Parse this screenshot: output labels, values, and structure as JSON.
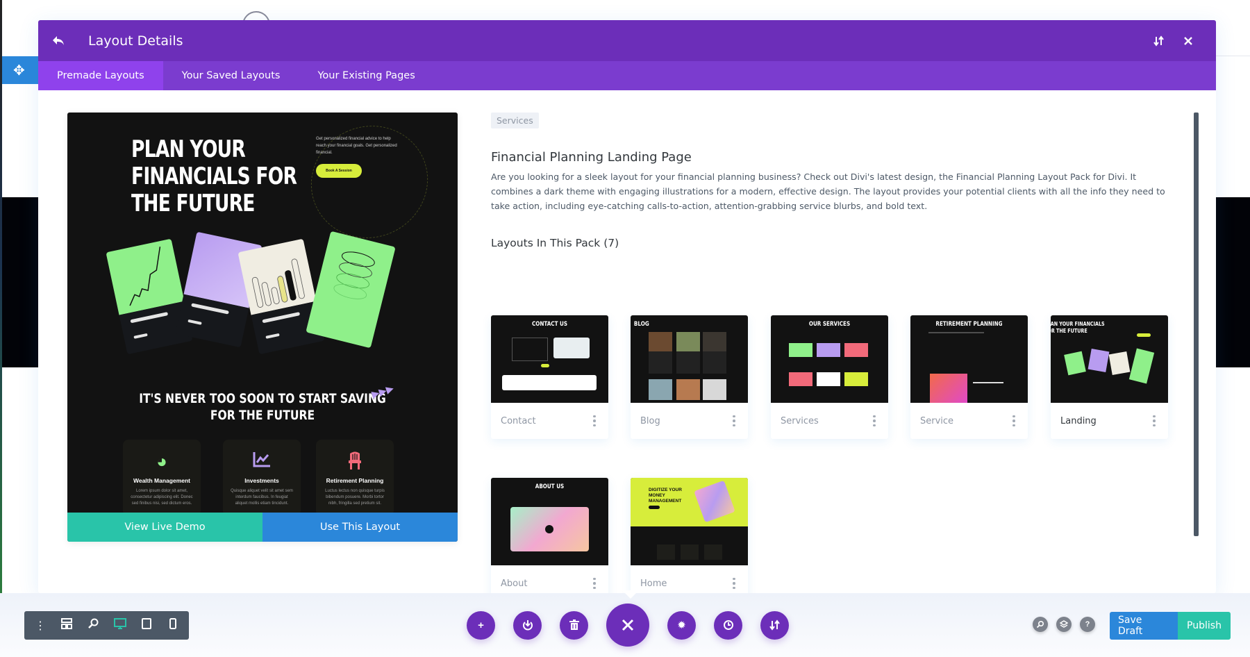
{
  "modal": {
    "title": "Layout Details",
    "back_icon": "back-arrow-icon",
    "sort_icon": "sort-arrows-icon",
    "close_icon": "close-icon",
    "tabs": [
      {
        "label": "Premade Layouts",
        "active": true
      },
      {
        "label": "Your Saved Layouts",
        "active": false
      },
      {
        "label": "Your Existing Pages",
        "active": false
      }
    ]
  },
  "preview": {
    "hero_title_lines": [
      "PLAN YOUR",
      "FINANCIALS FOR",
      "THE FUTURE"
    ],
    "hero_subtext": "Get personalized financial advice to help reach your financial goals. Get personalized financial.",
    "hero_button": "Book A Session",
    "section_title_lines": [
      "IT'S NEVER TOO SOON TO START SAVING",
      "FOR THE FUTURE"
    ],
    "services": [
      {
        "name": "Wealth Management",
        "icon": "pie-chart-icon",
        "color": "#8ff08a",
        "text": "Lorem ipsum dolor sit amet, consectetur adipiscing elit. Donec sed finibus nisi, sed dictum eros."
      },
      {
        "name": "Investments",
        "icon": "line-chart-icon",
        "color": "#b89cf0",
        "text": "Quisque aliquet velit sit amet sem interdum faucibus. In feugiat aliquet mollis etiam tincidunt."
      },
      {
        "name": "Retirement Planning",
        "icon": "chair-icon",
        "color": "#f26a7a",
        "text": "Luctus lectus non quisque turpis bibendum posuere. Morbi tortor nibh, fringilla sed pretium sit."
      }
    ],
    "view_demo_label": "View Live Demo",
    "use_layout_label": "Use This Layout"
  },
  "details": {
    "category_tag": "Services",
    "title": "Financial Planning Landing Page",
    "description": "Are you looking for a sleek layout for your financial planning business? Check out Divi's latest design, the Financial Planning Layout Pack for Divi. It combines a dark theme with engaging illustrations for a modern, effective design. The layout provides your potential clients with all the info they need to take action, including eye-catching calls-to-action, attention-grabbing service blurbs, and bold text.",
    "pack_title": "Layouts In This Pack (7)",
    "layouts": [
      {
        "name": "Contact",
        "thumb_title": "CONTACT US",
        "active": false
      },
      {
        "name": "Blog",
        "thumb_title": "BLOG",
        "active": false
      },
      {
        "name": "Services",
        "thumb_title": "OUR SERVICES",
        "active": false
      },
      {
        "name": "Service",
        "thumb_title": "RETIREMENT PLANNING",
        "active": false
      },
      {
        "name": "Landing",
        "thumb_title": "PLAN YOUR FINANCIALS FOR THE FUTURE",
        "active": true
      },
      {
        "name": "About",
        "thumb_title": "ABOUT US",
        "active": false
      },
      {
        "name": "Home",
        "thumb_title": "DIGITIZE YOUR MONEY MANAGEMENT",
        "active": false
      }
    ]
  },
  "toolbar": {
    "left_icons": [
      "more-vertical-icon",
      "wireframe-icon",
      "zoom-icon",
      "desktop-icon",
      "tablet-icon",
      "phone-icon"
    ],
    "active_view": "desktop-icon",
    "center_icons": [
      "add-icon",
      "portability-icon",
      "trash-icon",
      "close-icon",
      "settings-icon",
      "history-icon",
      "sort-icon"
    ],
    "right_icons": [
      "search-icon",
      "layers-icon",
      "help-icon"
    ],
    "save_draft_label": "Save Draft",
    "publish_label": "Publish"
  },
  "colors": {
    "header_purple": "#6c2eb9",
    "tab_purple": "#7b3ccf",
    "active_tab": "#8f42ec",
    "teal": "#29c4a9",
    "blue": "#2b87da",
    "toolbar_gray": "#4c5866"
  }
}
